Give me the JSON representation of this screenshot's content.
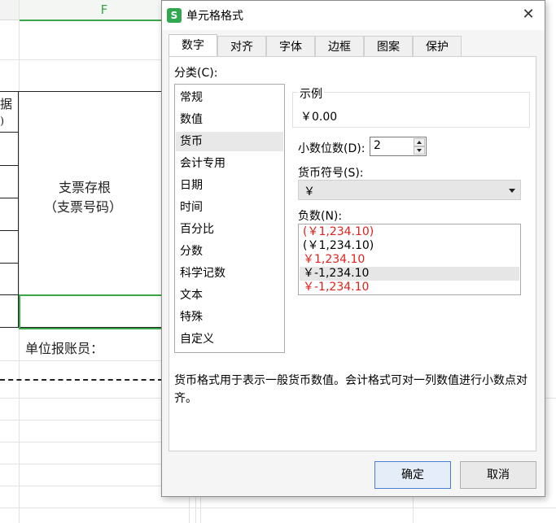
{
  "sheet": {
    "column_header": "F",
    "cell_top_fragment": "据",
    "cell_top_fragment2": ")",
    "stub_line1": "支票存根",
    "stub_line2": "（支票号码）",
    "footer_label": "单位报账员："
  },
  "dialog": {
    "title": "单元格格式",
    "app_icon": "S",
    "close_glyph": "✕",
    "tabs": [
      {
        "label": "数字",
        "active": true
      },
      {
        "label": "对齐"
      },
      {
        "label": "字体"
      },
      {
        "label": "边框"
      },
      {
        "label": "图案"
      },
      {
        "label": "保护"
      }
    ],
    "category_label": "分类(C):",
    "categories": [
      "常规",
      "数值",
      "货币",
      "会计专用",
      "日期",
      "时间",
      "百分比",
      "分数",
      "科学记数",
      "文本",
      "特殊",
      "自定义"
    ],
    "selected_category": "货币",
    "sample_label": "示例",
    "sample_value": "￥0.00",
    "decimal_label": "小数位数(D):",
    "decimal_value": "2",
    "symbol_label": "货币符号(S):",
    "symbol_value": "￥",
    "negative_label": "负数(N):",
    "negative_options": [
      {
        "text": "(￥1,234.10)",
        "color": "#e0201a"
      },
      {
        "text": "(￥1,234.10)",
        "color": "#000000"
      },
      {
        "text": "￥1,234.10",
        "color": "#e0201a"
      },
      {
        "text": "￥-1,234.10",
        "color": "#000000",
        "selected": true
      },
      {
        "text": "￥-1,234.10",
        "color": "#e0201a"
      }
    ],
    "description": "货币格式用于表示一般货币数值。会计格式可对一列数值进行小数点对齐。",
    "ok_label": "确定",
    "cancel_label": "取消"
  },
  "colors": {
    "accent_green": "#3aa64a",
    "negative_red": "#e0201a",
    "primary_button_border": "#4a7fd1"
  }
}
